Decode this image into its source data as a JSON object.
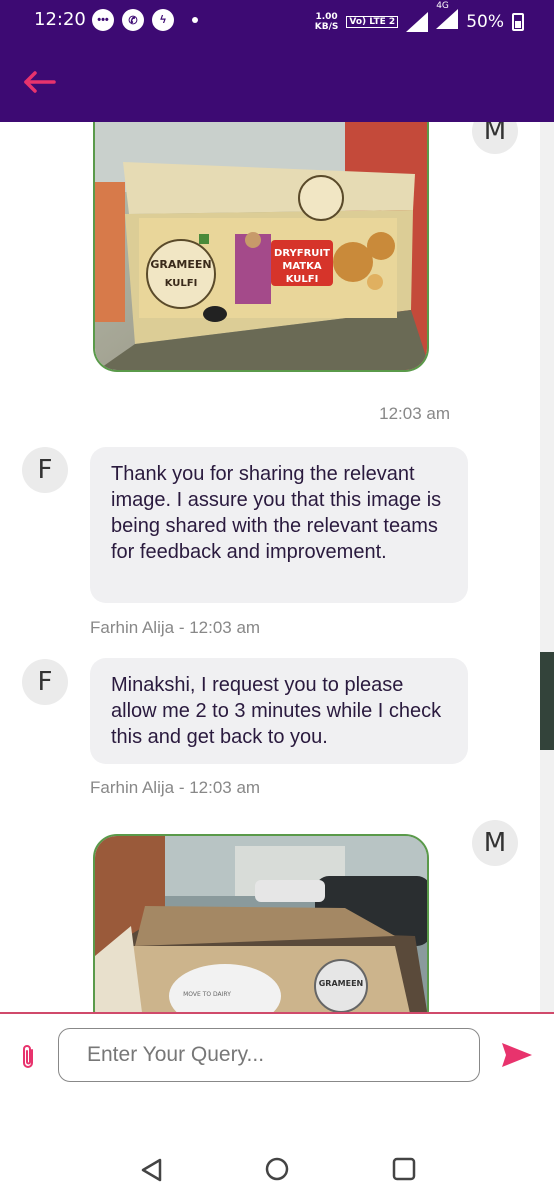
{
  "status_bar": {
    "time": "12:20",
    "net_speed_value": "1.00",
    "net_speed_unit": "KB/S",
    "lte_label": "Vo) LTE 2",
    "network_label": "4G",
    "battery": "50%"
  },
  "chat": {
    "messages": [
      {
        "sender_initial": "M",
        "type": "image",
        "time": "12:03 am"
      },
      {
        "sender_initial": "F",
        "type": "text",
        "text": "Thank you for sharing the relevant image. I assure you that this image is being shared with the relevant teams for feedback and improvement.",
        "meta": "Farhin Alija - 12:03 am"
      },
      {
        "sender_initial": "F",
        "type": "text",
        "text": "Minakshi, I request you to please allow me 2 to 3 minutes while I check this and get back to you.",
        "meta": "Farhin Alija - 12:03 am"
      },
      {
        "sender_initial": "M",
        "type": "image"
      }
    ],
    "image1": {
      "brand": "GRAMEEN",
      "brand_sub": "KULFI",
      "product_line1": "DRYFRUIT",
      "product_line2": "MATKA",
      "product_line3": "KULFI"
    },
    "image2": {
      "brand": "GRAMEEN",
      "tag": "MOVE TO DAIRY"
    }
  },
  "input": {
    "placeholder": "Enter Your Query..."
  },
  "colors": {
    "header": "#3d0a73",
    "accent": "#e8336d",
    "bubble": "#f0f0f2"
  }
}
